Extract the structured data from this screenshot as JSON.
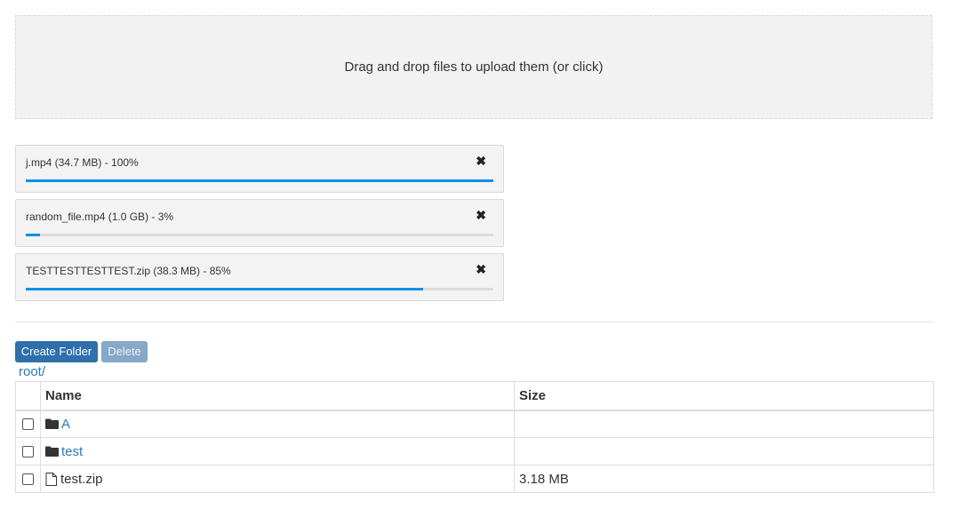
{
  "dropzone": {
    "text": "Drag and drop files to upload them (or click)"
  },
  "uploads": [
    {
      "label": "j.mp4 (34.7 MB) - 100%",
      "progress": 1.0,
      "close_icon": "close-icon"
    },
    {
      "label": "random_file.mp4 (1.0 GB) - 3%",
      "progress": 0.03,
      "close_icon": "close-icon"
    },
    {
      "label": "TESTTESTTESTTEST.zip (38.3 MB) - 85%",
      "progress": 0.85,
      "close_icon": "close-icon"
    }
  ],
  "toolbar": {
    "create_folder_label": "Create Folder",
    "delete_label": "Delete"
  },
  "breadcrumb": "root/",
  "table": {
    "headers": {
      "name": "Name",
      "size": "Size"
    },
    "rows": [
      {
        "type": "folder",
        "name": "A",
        "size": ""
      },
      {
        "type": "folder",
        "name": "test",
        "size": ""
      },
      {
        "type": "file",
        "name": "test.zip",
        "size": "3.18 MB"
      }
    ]
  },
  "colors": {
    "progress": "#0d8fe6",
    "primary_button": "#2f6fab",
    "link": "#2a7ab8"
  }
}
